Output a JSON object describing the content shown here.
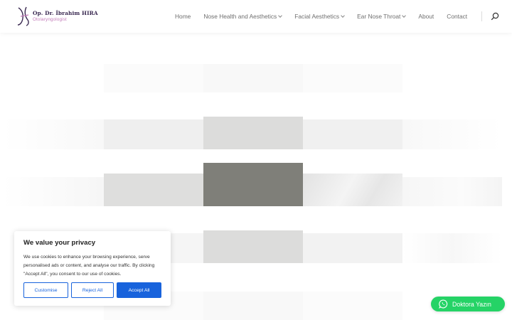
{
  "header": {
    "logo_name": "Op. Dr. İbrahim HIRA",
    "logo_subtitle": "Otolaryngologist",
    "nav": [
      {
        "label": "Home",
        "dropdown": false
      },
      {
        "label": "Nose Health and Aesthetics",
        "dropdown": true
      },
      {
        "label": "Facial Aesthetics",
        "dropdown": true
      },
      {
        "label": "Ear Nose Throat",
        "dropdown": true
      },
      {
        "label": "About",
        "dropdown": false
      },
      {
        "label": "Contact",
        "dropdown": false
      }
    ],
    "search_icon": "search-icon"
  },
  "cookie": {
    "title": "We value your privacy",
    "text": "We use cookies to enhance your browsing experience, serve personalised ads or content, and analyse our traffic. By clicking \"Accept All\", you consent to our use of cookies.",
    "customise_label": "Customise",
    "reject_label": "Reject All",
    "accept_label": "Accept All",
    "accent_color": "#1863dc"
  },
  "whatsapp": {
    "label": "Doktora Yazın",
    "icon": "whatsapp-icon",
    "color": "#25d366"
  }
}
